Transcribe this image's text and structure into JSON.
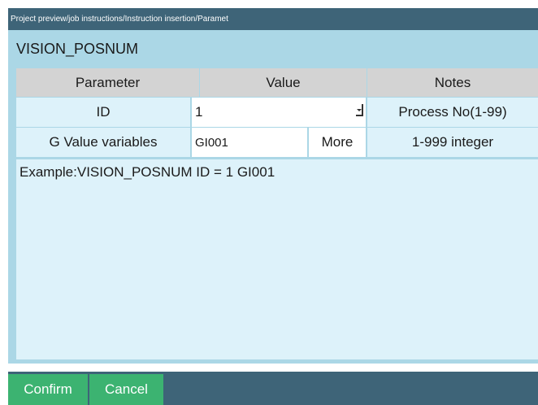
{
  "breadcrumb": "Project preview/job instructions/Instruction insertion/Paramet",
  "command_name": "VISION_POSNUM",
  "table": {
    "headers": [
      "Parameter",
      "Value",
      "Notes"
    ],
    "rows": [
      {
        "parameter": "ID",
        "value": "1",
        "notes": "Process No(1-99)"
      },
      {
        "parameter": "G Value variables",
        "value": "GI001",
        "button": "More",
        "notes": "1-999 integer"
      }
    ]
  },
  "example": "Example:VISION_POSNUM ID = 1 GI001",
  "buttons": {
    "confirm": "Confirm",
    "cancel": "Cancel"
  },
  "colors": {
    "titlebar": "#3e6478",
    "panel": "#abd7e6",
    "row": "#ddf2fa",
    "header": "#d3d3d3",
    "button": "#3cb371"
  }
}
